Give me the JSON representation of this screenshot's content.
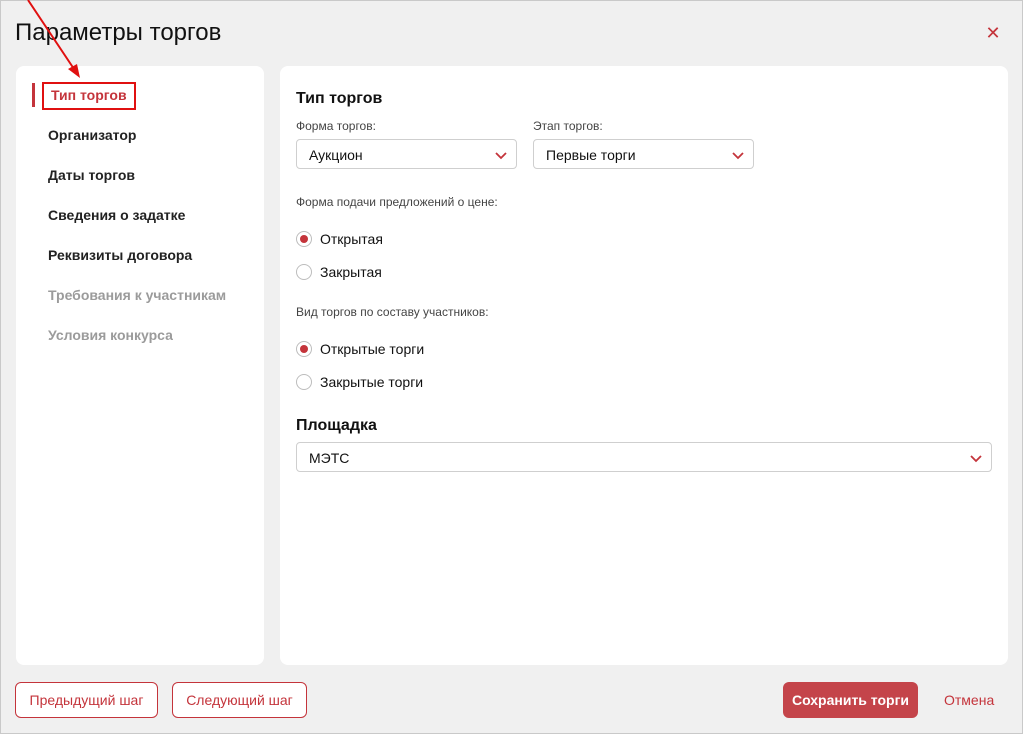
{
  "modal": {
    "title": "Параметры торгов",
    "close_icon": "close-icon"
  },
  "sidebar": {
    "items": [
      {
        "label": "Тип торгов",
        "state": "active"
      },
      {
        "label": "Организатор",
        "state": "enabled"
      },
      {
        "label": "Даты торгов",
        "state": "enabled"
      },
      {
        "label": "Сведения о задатке",
        "state": "enabled"
      },
      {
        "label": "Реквизиты договора",
        "state": "enabled"
      },
      {
        "label": "Требования к участникам",
        "state": "disabled"
      },
      {
        "label": "Условия конкурса",
        "state": "disabled"
      }
    ]
  },
  "main": {
    "section_title": "Тип торгов",
    "form_label": "Форма торгов:",
    "form_value": "Аукцион",
    "stage_label": "Этап торгов:",
    "stage_value": "Первые торги",
    "price_label": "Форма подачи предложений о цене:",
    "price_options": [
      {
        "label": "Открытая",
        "checked": true
      },
      {
        "label": "Закрытая",
        "checked": false
      }
    ],
    "participants_label": "Вид торгов по составу участников:",
    "participant_options": [
      {
        "label": "Открытые торги",
        "checked": true
      },
      {
        "label": "Закрытые торги",
        "checked": false
      }
    ],
    "platform_title": "Площадка",
    "platform_value": "МЭТС"
  },
  "footer": {
    "prev_label": "Предыдущий шаг",
    "next_label": "Следующий шаг",
    "save_label": "Сохранить торги",
    "cancel_label": "Отмена"
  },
  "colors": {
    "accent": "#c4343b",
    "annotation": "#e01010",
    "background": "#f0f0f0"
  }
}
